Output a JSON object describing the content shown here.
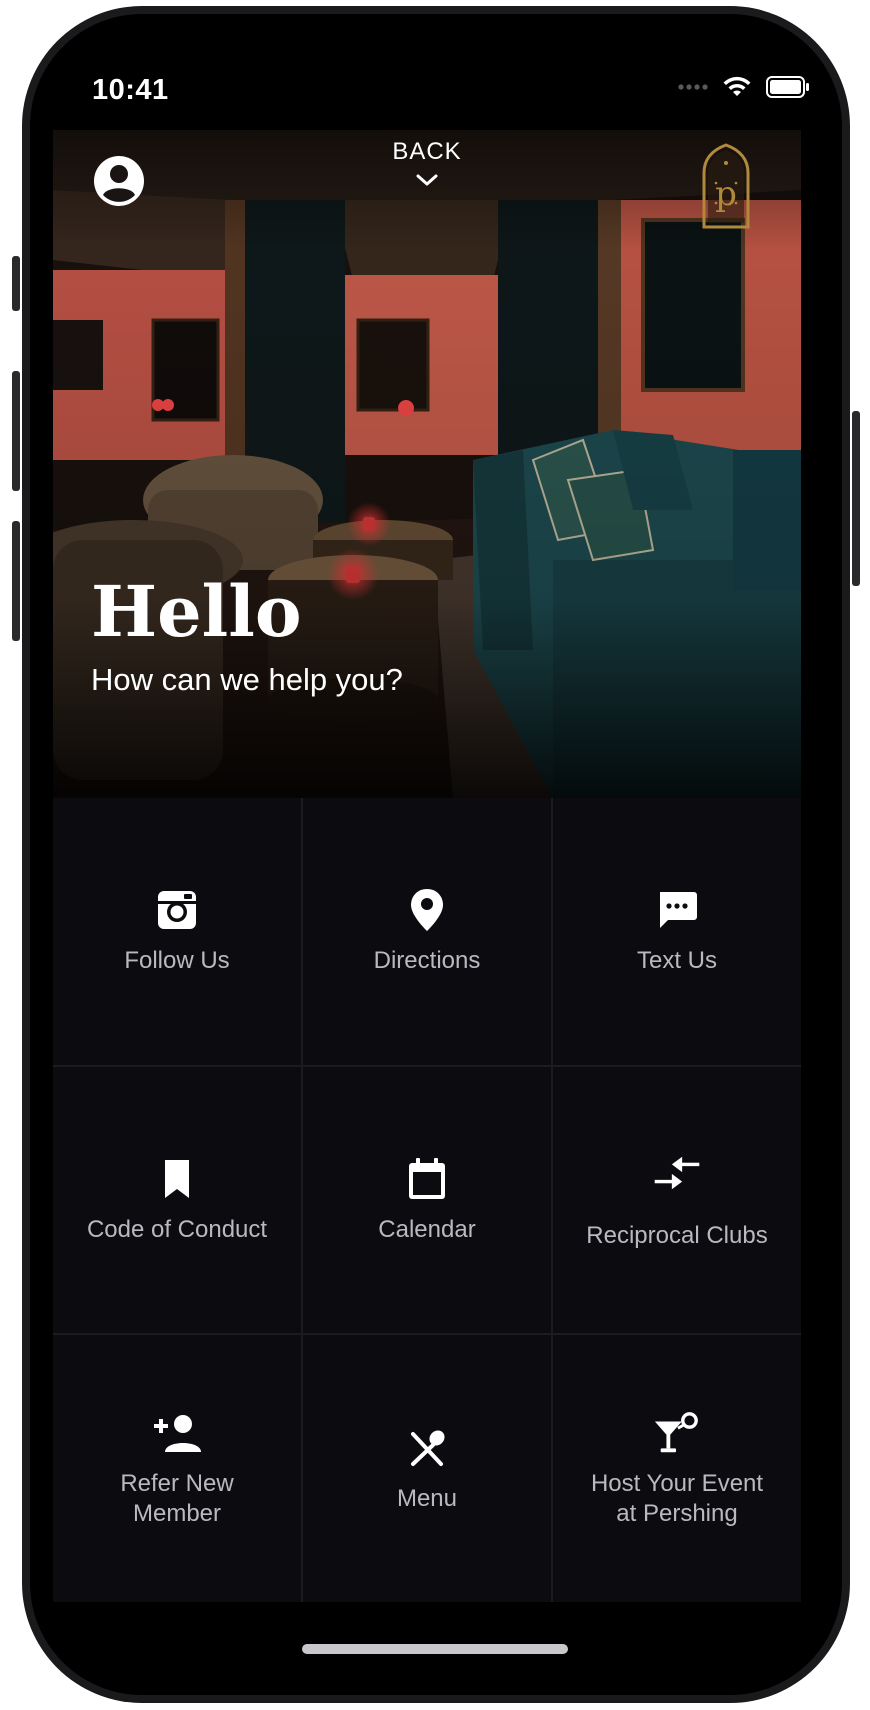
{
  "status_bar": {
    "time": "10:41"
  },
  "header": {
    "back_label": "BACK"
  },
  "hero": {
    "greeting": "Hello",
    "subtitle": "How can we help you?"
  },
  "tiles": [
    {
      "label": "Follow Us",
      "icon": "instagram-icon"
    },
    {
      "label": "Directions",
      "icon": "location-pin-icon"
    },
    {
      "label": "Text Us",
      "icon": "message-icon"
    },
    {
      "label": "Code of Conduct",
      "icon": "bookmark-icon"
    },
    {
      "label": "Calendar",
      "icon": "calendar-icon"
    },
    {
      "label": "Reciprocal Clubs",
      "icon": "swap-arrows-icon"
    },
    {
      "label": "Refer New\nMember",
      "icon": "add-person-icon"
    },
    {
      "label": "Menu",
      "icon": "utensils-icon"
    },
    {
      "label": "Host Your Event\nat Pershing",
      "icon": "cocktail-icon"
    }
  ],
  "colors": {
    "background": "#0b0b0e",
    "tile": "#0c0c10",
    "label": "#b9b9bf",
    "accent_gold": "#b08a3a",
    "wall": "#d7604f",
    "sofa": "#1f4f55"
  }
}
